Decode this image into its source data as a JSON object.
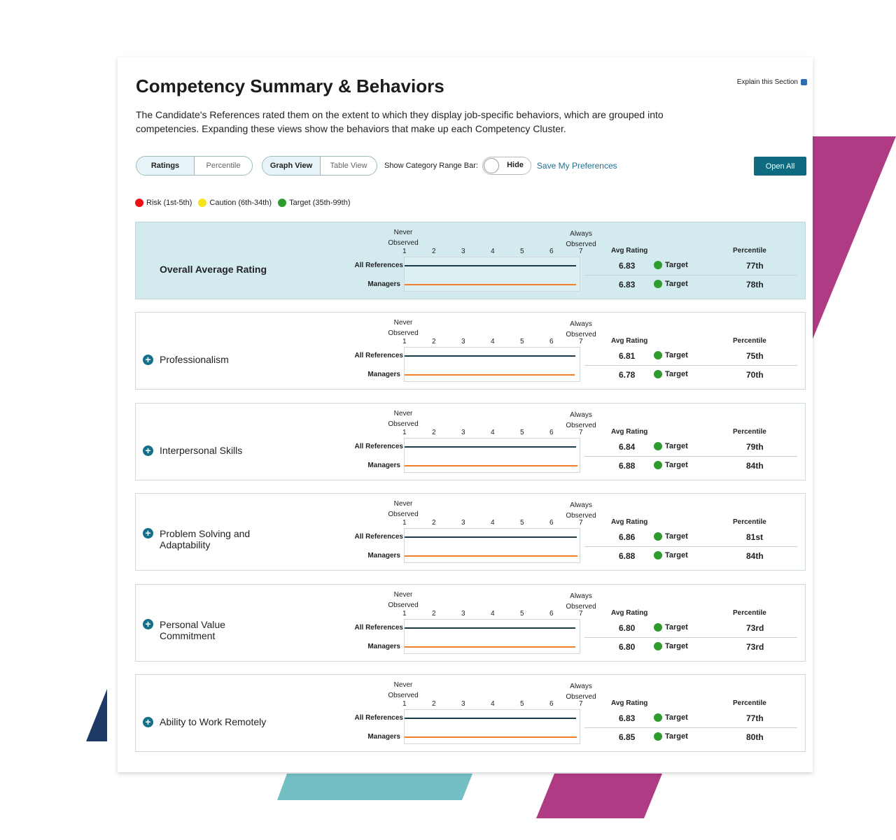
{
  "header": {
    "title": "Competency Summary & Behaviors",
    "explain_label": "Explain this Section",
    "description": "The Candidate's References rated them on the extent to which they display job-specific behaviors, which are grouped into competencies. Expanding these views show the behaviors that make up each Competency Cluster."
  },
  "controls": {
    "ratings_label": "Ratings",
    "percentile_label": "Percentile",
    "graph_view_label": "Graph View",
    "table_view_label": "Table View",
    "range_bar_label": "Show Category Range Bar:",
    "toggle_label": "Hide",
    "save_label": "Save My Preferences",
    "open_all_label": "Open All"
  },
  "legend": [
    {
      "label": "Risk (1st-5th)",
      "color": "#ee1111"
    },
    {
      "label": "Caution (6th-34th)",
      "color": "#f4e21a"
    },
    {
      "label": "Target (35th-99th)",
      "color": "#2e9b2e"
    }
  ],
  "scale": {
    "never_label": "Never Observed",
    "always_label": "Always Observed",
    "ticks": [
      "1",
      "2",
      "3",
      "4",
      "5",
      "6",
      "7"
    ],
    "avg_header": "Avg Rating",
    "percentile_header": "Percentile",
    "series_labels": [
      "All References",
      "Managers"
    ]
  },
  "colors": {
    "all_references": "#1a3a47",
    "managers": "#f07f2a",
    "accent": "#0f6c80"
  },
  "rows": [
    {
      "name": "Overall Average Rating",
      "overall": true,
      "all": {
        "avg": "6.83",
        "status": "Target",
        "pct": "77th"
      },
      "mgr": {
        "avg": "6.83",
        "status": "Target",
        "pct": "78th"
      }
    },
    {
      "name": "Professionalism",
      "all": {
        "avg": "6.81",
        "status": "Target",
        "pct": "75th"
      },
      "mgr": {
        "avg": "6.78",
        "status": "Target",
        "pct": "70th"
      }
    },
    {
      "name": "Interpersonal Skills",
      "all": {
        "avg": "6.84",
        "status": "Target",
        "pct": "79th"
      },
      "mgr": {
        "avg": "6.88",
        "status": "Target",
        "pct": "84th"
      }
    },
    {
      "name": "Problem Solving and Adaptability",
      "all": {
        "avg": "6.86",
        "status": "Target",
        "pct": "81st"
      },
      "mgr": {
        "avg": "6.88",
        "status": "Target",
        "pct": "84th"
      }
    },
    {
      "name": "Personal Value Commitment",
      "all": {
        "avg": "6.80",
        "status": "Target",
        "pct": "73rd"
      },
      "mgr": {
        "avg": "6.80",
        "status": "Target",
        "pct": "73rd"
      }
    },
    {
      "name": "Ability to Work Remotely",
      "all": {
        "avg": "6.83",
        "status": "Target",
        "pct": "77th"
      },
      "mgr": {
        "avg": "6.85",
        "status": "Target",
        "pct": "80th"
      }
    }
  ]
}
